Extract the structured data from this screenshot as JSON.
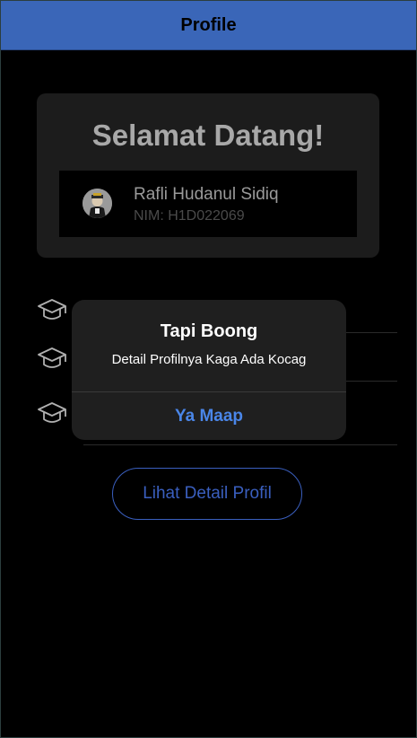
{
  "header": {
    "title": "Profile"
  },
  "welcome": {
    "title": "Selamat Datang!",
    "user_name": "Rafli Hudanul Sidiq",
    "user_nim": "NIM: H1D022069"
  },
  "list": {
    "items": [
      {
        "icon": "graduation-cap-icon"
      },
      {
        "icon": "graduation-cap-icon"
      },
      {
        "icon": "graduation-cap-icon"
      }
    ]
  },
  "detail_button": {
    "label": "Lihat Detail Profil"
  },
  "dialog": {
    "title": "Tapi Boong",
    "message": "Detail Profilnya Kaga Ada Kocag",
    "action_label": "Ya Maap"
  },
  "colors": {
    "header_bg": "#3a66b8",
    "accent": "#4a86e8",
    "button_outline": "#3a5fbf"
  }
}
